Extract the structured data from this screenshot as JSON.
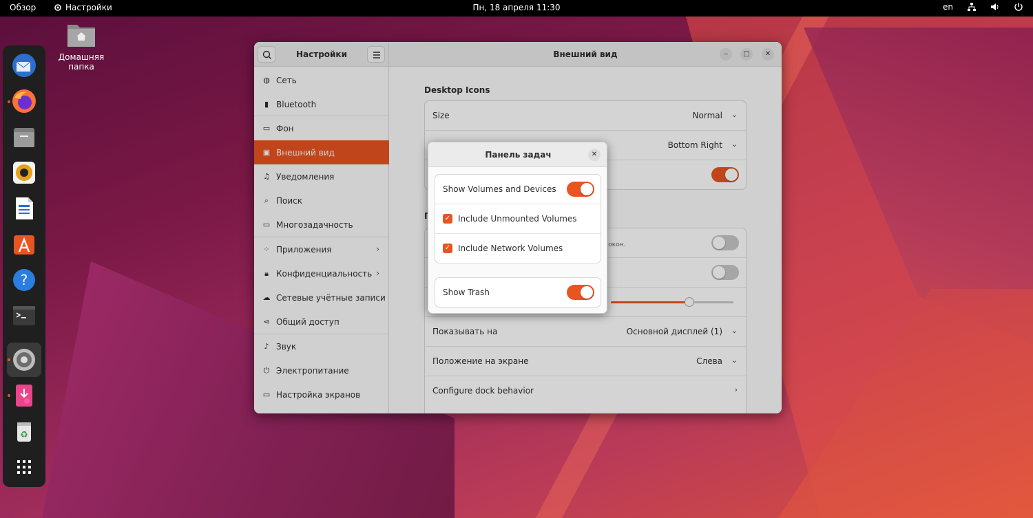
{
  "topbar": {
    "activities": "Обзор",
    "app_name": "Настройки",
    "clock": "Пн, 18 апреля  11:30",
    "lang": "en",
    "icons": [
      "network-icon",
      "volume-icon",
      "power-icon"
    ]
  },
  "desktop": {
    "home_label_line1": "Домашняя",
    "home_label_line2": "папка"
  },
  "dock": {
    "items": [
      "thunderbird",
      "firefox",
      "files",
      "rhythmbox",
      "libreoffice-writer",
      "app-center",
      "help",
      "terminal",
      "settings",
      "app-installer",
      "trash",
      "show-apps"
    ]
  },
  "window": {
    "sidebar_title": "Настройки",
    "main_title": "Внешний вид",
    "sidebar": [
      {
        "label": "Сеть",
        "icon": "globe-icon"
      },
      {
        "label": "Bluetooth",
        "icon": "bluetooth-icon"
      },
      {
        "label": "Фон",
        "icon": "display-icon"
      },
      {
        "label": "Внешний вид",
        "icon": "appearance-icon",
        "active": true
      },
      {
        "label": "Уведомления",
        "icon": "bell-icon"
      },
      {
        "label": "Поиск",
        "icon": "search-icon"
      },
      {
        "label": "Многозадачность",
        "icon": "multitasking-icon"
      },
      {
        "label": "Приложения",
        "icon": "apps-icon"
      },
      {
        "label": "Конфиденциальность",
        "icon": "lock-icon"
      },
      {
        "label": "Сетевые учётные записи",
        "icon": "cloud-icon"
      },
      {
        "label": "Общий доступ",
        "icon": "share-icon"
      },
      {
        "label": "Звук",
        "icon": "music-icon"
      },
      {
        "label": "Электропитание",
        "icon": "power-icon"
      },
      {
        "label": "Настройка экранов",
        "icon": "monitor-icon"
      }
    ],
    "desktop_icons": {
      "section": "Desktop Icons",
      "size_label": "Size",
      "size_value": "Normal",
      "position_value": "Bottom Right"
    },
    "dock_section": {
      "section_prefix": "П",
      "autohide_sub": "к окон.",
      "show_on_label": "Показывать на",
      "show_on_value": "Основной дисплей (1)",
      "screen_pos_label": "Положение на экране",
      "screen_pos_value": "Слева",
      "configure_label": "Configure dock behavior",
      "icon_size_fraction": 0.64
    }
  },
  "popup": {
    "title": "Панель задач",
    "show_volumes": "Show Volumes and Devices",
    "include_unmounted": "Include Unmounted Volumes",
    "include_network": "Include Network Volumes",
    "show_trash": "Show Trash"
  },
  "colors": {
    "accent": "#e95420"
  }
}
